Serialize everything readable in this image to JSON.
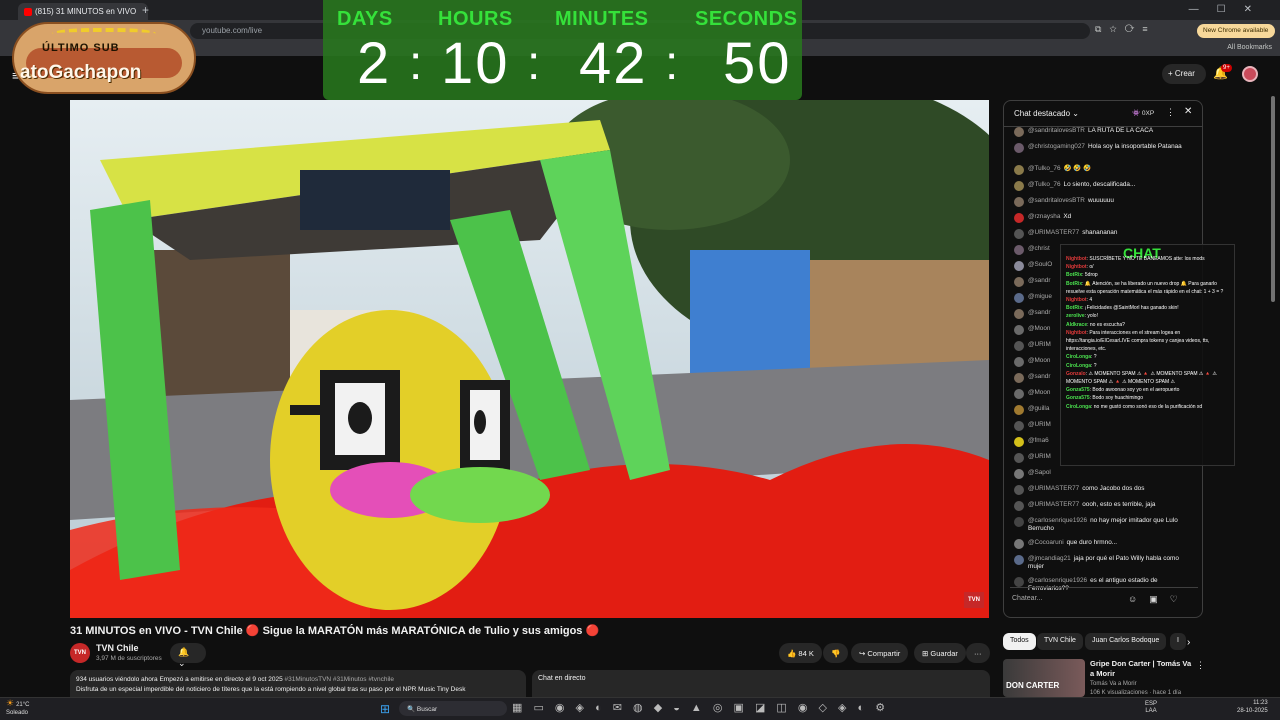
{
  "browser": {
    "tab_title": "(815) 31 MINUTOS en VIVO",
    "new_tab": "+",
    "window_controls": "—☐✕",
    "omnibox": "youtube.com/live",
    "toolbar_icons": "⧉☆⟳≡",
    "update_button": "New Chrome available",
    "all_bookmarks": "All Bookmarks"
  },
  "youtube": {
    "menu_icon": "≡",
    "create_label": "+ Crear",
    "bell_icon": "🔔",
    "notifications": "9+"
  },
  "countdown": {
    "labels": [
      "DAYS",
      "HOURS",
      "MINUTES",
      "SECONDS"
    ],
    "values": [
      "2",
      "10",
      "42",
      "50"
    ],
    "sep": ":"
  },
  "sub_badge": {
    "top_text": "ÚLTIMO  SUB",
    "name": "atoGachapon"
  },
  "video": {
    "watermark": "TVN"
  },
  "meta": {
    "title": "31 MINUTOS en VIVO - TVN Chile 🔴 Sigue la MARATÓN más MARATÓNICA de Tulio y sus amigos 🔴",
    "channel": "TVN Chile",
    "channel_logo": "TVN",
    "subscribers": "3,97 M de suscriptores",
    "bell_btn": "🔔 ⌄",
    "likes": "👍 84 K",
    "dislike": "👎",
    "share": "↪ Compartir",
    "save": "⊞ Guardar",
    "more": "···",
    "desc_stats": "934 usuarios viéndolo ahora  Empezó a emitirse en directo el 9 oct 2025",
    "desc_tags": "#31MinutosTVN #31Minutos #tvnchile",
    "desc_text": "Disfruta de un especial imperdible del noticiero de títeres que la está rompiendo a nivel global tras su paso por el NPR Music Tiny Desk",
    "chat_directo": "Chat en directo"
  },
  "chat": {
    "header": "Chat destacado ⌄",
    "points": "👾 0XP",
    "more": "⋮",
    "close": "✕",
    "messages": [
      {
        "user": "@sandritalovesBTR",
        "text": "LA RUTA DE LA CACA",
        "color": "#7a6a5a"
      },
      {
        "user": "@christogaming027",
        "text": "Hola soy la insoportable Patanaa",
        "color": "#6b5a6a",
        "tall": true
      },
      {
        "user": "@Tulko_76",
        "text": "🤣 🤣 🤣",
        "color": "#8a7a4a"
      },
      {
        "user": "@Tulko_76",
        "text": "Lo siento, descalificada...",
        "color": "#8a7a4a"
      },
      {
        "user": "@sandritalovesBTR",
        "text": "wuuuuuu",
        "color": "#7a6a5a"
      },
      {
        "user": "@rznaysha",
        "text": "Xd",
        "color": "#c62828"
      },
      {
        "user": "@URIMASTER77",
        "text": "shanananan",
        "color": "#555"
      },
      {
        "user": "@christ",
        "text": "",
        "color": "#6b5a6a"
      },
      {
        "user": "@SoulO",
        "text": "",
        "color": "#8a8a9a"
      },
      {
        "user": "@sandr",
        "text": "",
        "color": "#7a6a5a"
      },
      {
        "user": "@migue",
        "text": "",
        "color": "#5a6a8a"
      },
      {
        "user": "@sandr",
        "text": "",
        "color": "#7a6a5a"
      },
      {
        "user": "@Moon",
        "text": "",
        "color": "#6a6a6a"
      },
      {
        "user": "@URIM",
        "text": "",
        "color": "#555"
      },
      {
        "user": "@Moon",
        "text": "",
        "color": "#6a6a6a"
      },
      {
        "user": "@sandr",
        "text": "",
        "color": "#7a6a5a"
      },
      {
        "user": "@Moon",
        "text": "",
        "color": "#6a6a6a"
      },
      {
        "user": "@guilla",
        "text": "",
        "color": "#a07a30"
      },
      {
        "user": "@URIM",
        "text": "",
        "color": "#555"
      },
      {
        "user": "@fma6",
        "text": "",
        "color": "#d4c01a"
      },
      {
        "user": "@URIM",
        "text": "",
        "color": "#555"
      },
      {
        "user": "@Sapol",
        "text": "",
        "color": "#777"
      },
      {
        "user": "@URIMASTER77",
        "text": "como Jacobo dos dos",
        "color": "#555"
      },
      {
        "user": "@URIMASTER77",
        "text": "oooh, esto es terrible, jaja",
        "color": "#555"
      },
      {
        "user": "@carlosenrique1926",
        "text": "no hay mejor imitador que Lulo Berrucho",
        "color": "#444",
        "tall": true
      },
      {
        "user": "@Cocoaruni",
        "text": "que duro hrmno...",
        "color": "#777"
      },
      {
        "user": "@jmcandiag21",
        "text": "jaja por qué el Pato Willy habla como mujer",
        "color": "#5a6a8a",
        "tall": true
      },
      {
        "user": "@carlosenrique1926",
        "text": "es el antiguo estadio de Ferroviarios??",
        "color": "#444",
        "tall": true
      }
    ],
    "input_placeholder": "Chatear...",
    "input_icons": "☺▣♡"
  },
  "stream_chat": {
    "header": "CHAT",
    "lines": [
      {
        "u": "Nightbot",
        "r": true,
        "t": ": SUSCRÍBETE Y NO TE BANEAMOS atte: los mods"
      },
      {
        "u": "Nightbot",
        "r": true,
        "t": ": o/"
      },
      {
        "u": "BotRix",
        "t": ": 5drop"
      },
      {
        "u": "BotRix",
        "t": ": 🔔 Atención, se ha liberado un nuevo drop 🔔 Para ganarlo resuelve esta operación matemática el más rápido en el chat: 1 + 3 = ?"
      },
      {
        "u": "Nightbot",
        "r": true,
        "t": ": 4"
      },
      {
        "u": "BotRix",
        "t": ": ¡Felicidades @SaintMorl has ganado skin!"
      },
      {
        "u": "zerolive",
        "t": ": yolo!"
      },
      {
        "u": "Aldkrace",
        "t": ": no es escucha?"
      },
      {
        "u": "Nightbot",
        "r": true,
        "t": ": Para interacciones en el stream logea en https://tangia.io/ElCesarLIVE compra tokens y canjea videos, tts, interacciones, etc."
      },
      {
        "u": "CiroLonga",
        "t": ": ?"
      },
      {
        "u": "CiroLonga",
        "t": ": ?"
      },
      {
        "u": "Gonzalo",
        "r": true,
        "t": ": ⚠ MOMENTO SPAM ⚠ 🔺 ⚠ MOMENTO SPAM ⚠ 🔺 ⚠ MOMENTO SPAM ⚠ 🔺 ⚠ MOMENTO SPAM ⚠"
      },
      {
        "u": "Gonza575",
        "t": ": Bodo awoonao soy yo en el aeropuerto"
      },
      {
        "u": "Gonza575",
        "t": ": Bodo soy huachimingo"
      },
      {
        "u": "CiroLonga",
        "t": ": no me gustó como sonó eso de la purificación xd"
      }
    ]
  },
  "recs": {
    "chips": [
      "Todos",
      "TVN Chile",
      "Juan Carlos Bodoque",
      "I"
    ],
    "arrow": "›",
    "thumb_text": "DON CARTER",
    "title": "Gripe Don Carter | Tomás Va a Morir",
    "channel": "Tomás Va a Morir",
    "views": "106 K visualizaciones · hace 1 día",
    "more": "⋮"
  },
  "taskbar": {
    "temp": "21°C",
    "weather": "Soleado",
    "weather_icon": "☀",
    "start_icon": "⊞",
    "search_placeholder": "🔍 Buscar",
    "apps": "▦ ▭ ◉ ◈ ◐ ✉ ◍ ◆ ◒ ▲ ◎ ▣ ◪ ◫ ◉ ◇ ◈ ◐ ⚙",
    "lang": "ESP",
    "layout": "LAA",
    "time": "11:23",
    "date": "28-10-2025"
  }
}
